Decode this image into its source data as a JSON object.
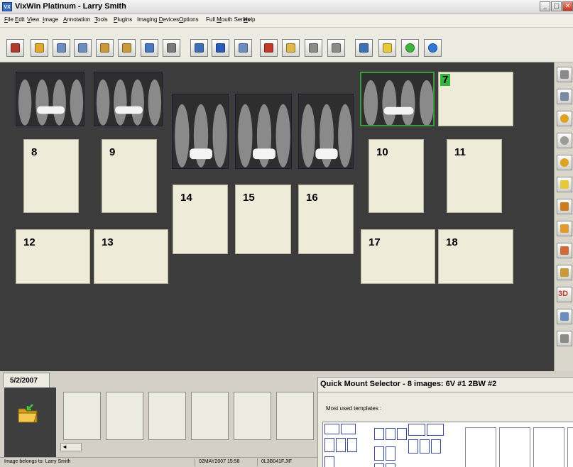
{
  "window": {
    "title": "VixWin Platinum - Larry Smith",
    "app_icon": "VX",
    "minimize": "_",
    "maximize": "□",
    "close": "✕"
  },
  "menu": [
    {
      "label": "File",
      "underline": "F",
      "rest": "ile"
    },
    {
      "label": "Edit",
      "underline": "E",
      "rest": "dit"
    },
    {
      "label": "View",
      "underline": "V",
      "rest": "iew"
    },
    {
      "label": "Image",
      "underline": "I",
      "rest": "mage"
    },
    {
      "label": "Annotation",
      "underline": "A",
      "rest": "nnotation"
    },
    {
      "label": "Tools",
      "underline": "T",
      "rest": "ools"
    },
    {
      "label": "Plugins",
      "underline": "P",
      "rest": "lugins"
    },
    {
      "label": "Imaging Devices",
      "pre": "Imaging ",
      "underline": "D",
      "rest": "evices"
    },
    {
      "label": "Options",
      "underline": "O",
      "rest": "ptions"
    },
    {
      "label": "Full Mouth Series",
      "pre": "Full ",
      "underline": "M",
      "rest": "outh Series"
    },
    {
      "label": "Help",
      "underline": "H",
      "rest": "elp"
    }
  ],
  "toolbar_icons": [
    "patient-icon",
    "open-folder-icon",
    "document-icon",
    "copy-icon",
    "paste-icon",
    "paste-special-icon",
    "mail-icon",
    "print-icon",
    "scanner-icon",
    "calibrate-icon",
    "save-icon",
    "tooth-icon",
    "pencil-icon",
    "ruler-icon",
    "text-icon",
    "window-icon",
    "grid-icon",
    "ok-icon",
    "info-icon"
  ],
  "mount": {
    "xray_slots": [
      {
        "id": "xray-1",
        "selected": false
      },
      {
        "id": "xray-2",
        "selected": false
      },
      {
        "id": "xray-3",
        "selected": false
      },
      {
        "id": "xray-4",
        "selected": false
      },
      {
        "id": "xray-5",
        "selected": false
      },
      {
        "id": "xray-6",
        "selected": true
      }
    ],
    "empty_slots": [
      {
        "num": "7",
        "highlight": true
      },
      {
        "num": "8"
      },
      {
        "num": "9"
      },
      {
        "num": "10"
      },
      {
        "num": "11"
      },
      {
        "num": "12"
      },
      {
        "num": "13"
      },
      {
        "num": "14"
      },
      {
        "num": "15"
      },
      {
        "num": "16"
      },
      {
        "num": "17"
      },
      {
        "num": "18"
      }
    ]
  },
  "sidebar_icons": [
    "rotate-icon",
    "flip-icon",
    "zoom-in-icon",
    "zoom-out-icon",
    "zoom-fit-icon",
    "brightness-icon",
    "contrast-icon",
    "sharpen-icon",
    "tooth-icon",
    "implant-icon",
    "3d-view-icon",
    "measure-icon",
    "book-icon"
  ],
  "sidebar_3d_label": "3D",
  "thumbnails": {
    "date_tab": "5/2/2007",
    "count": 6,
    "scroll_arrow": "◄"
  },
  "quick_mount": {
    "title": "Quick Mount Selector - 8 images: 6V #1  2BW #2",
    "subtitle": "Most used templates :"
  },
  "status": {
    "owner": "Image belongs to: Larry Smith",
    "datetime": "02MAY2007 15:58",
    "filename": "0L3B041F.JIF"
  },
  "colors": {
    "workspace_bg": "#3c3c3c",
    "slot_bg": "#efebd9",
    "selected_border": "#3e9a3c",
    "highlight_green": "#38b43c"
  }
}
